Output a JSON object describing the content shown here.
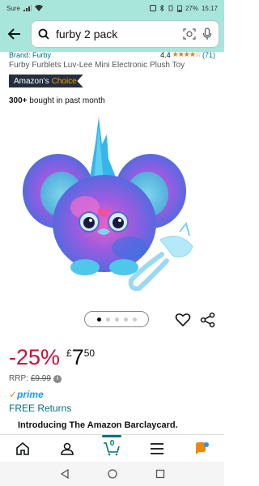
{
  "status": {
    "carrier": "Sure",
    "battery": "27%",
    "time": "15:17"
  },
  "search": {
    "query": "furby 2 pack"
  },
  "product": {
    "brand": "Brand: Furby",
    "rating": "4.4",
    "stars": "★★★★☆",
    "rating_count": "(71)",
    "title": "Furby Furblets Luv-Lee Mini Electronic Plush Toy",
    "choice_prefix": "Amazon's",
    "choice_word": "Choice",
    "bought_bold": "300+",
    "bought_rest": " bought in past month"
  },
  "price": {
    "discount": "-25%",
    "currency": "£",
    "whole": "7",
    "fraction": "50",
    "rrp_label": "RRP:",
    "rrp_value": "£9.99"
  },
  "prime": {
    "check": "✓",
    "word": "prime"
  },
  "free_returns": "FREE Returns",
  "promo": "Introducing The Amazon Barclaycard.",
  "cart": {
    "count": "0"
  },
  "colors": {
    "header_bg": "#a8e6dc",
    "accent": "#007185",
    "discount": "#cc0c39",
    "star": "#de7921"
  }
}
